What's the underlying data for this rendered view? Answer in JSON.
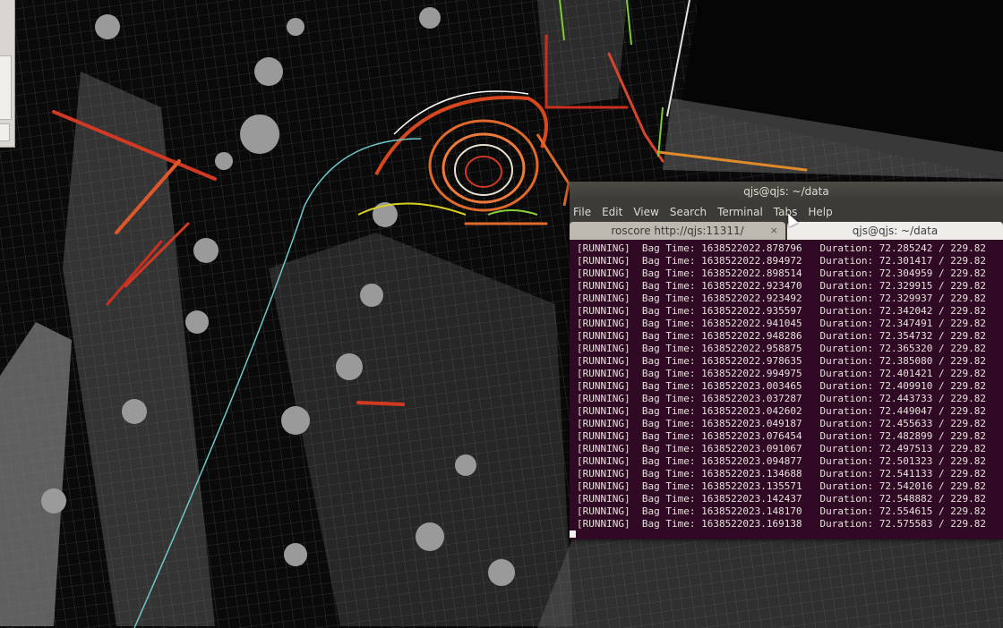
{
  "terminal": {
    "title": "qjs@qjs: ~/data",
    "menu": [
      "File",
      "Edit",
      "View",
      "Search",
      "Terminal",
      "Tabs",
      "Help"
    ],
    "tabs": [
      {
        "label": "roscore http://qjs:11311/",
        "close": "×"
      },
      {
        "label": "qjs@qjs: ~/data"
      }
    ],
    "lines": [
      "[RUNNING]  Bag Time: 1638522022.878796   Duration: 72.285242 / 229.82",
      "[RUNNING]  Bag Time: 1638522022.894972   Duration: 72.301417 / 229.82",
      "[RUNNING]  Bag Time: 1638522022.898514   Duration: 72.304959 / 229.82",
      "[RUNNING]  Bag Time: 1638522022.923470   Duration: 72.329915 / 229.82",
      "[RUNNING]  Bag Time: 1638522022.923492   Duration: 72.329937 / 229.82",
      "[RUNNING]  Bag Time: 1638522022.935597   Duration: 72.342042 / 229.82",
      "[RUNNING]  Bag Time: 1638522022.941045   Duration: 72.347491 / 229.82",
      "[RUNNING]  Bag Time: 1638522022.948286   Duration: 72.354732 / 229.82",
      "[RUNNING]  Bag Time: 1638522022.958875   Duration: 72.365320 / 229.82",
      "[RUNNING]  Bag Time: 1638522022.978635   Duration: 72.385080 / 229.82",
      "[RUNNING]  Bag Time: 1638522022.994975   Duration: 72.401421 / 229.82",
      "[RUNNING]  Bag Time: 1638522023.003465   Duration: 72.409910 / 229.82",
      "[RUNNING]  Bag Time: 1638522023.037287   Duration: 72.443733 / 229.82",
      "[RUNNING]  Bag Time: 1638522023.042602   Duration: 72.449047 / 229.82",
      "[RUNNING]  Bag Time: 1638522023.049187   Duration: 72.455633 / 229.82",
      "[RUNNING]  Bag Time: 1638522023.076454   Duration: 72.482899 / 229.82",
      "[RUNNING]  Bag Time: 1638522023.091067   Duration: 72.497513 / 229.82",
      "[RUNNING]  Bag Time: 1638522023.094877   Duration: 72.501323 / 229.82",
      "[RUNNING]  Bag Time: 1638522023.134688   Duration: 72.541133 / 229.82",
      "[RUNNING]  Bag Time: 1638522023.135571   Duration: 72.542016 / 229.82",
      "[RUNNING]  Bag Time: 1638522023.142437   Duration: 72.548882 / 229.82",
      "[RUNNING]  Bag Time: 1638522023.148170   Duration: 72.554615 / 229.82",
      "[RUNNING]  Bag Time: 1638522023.169138   Duration: 72.575583 / 229.82"
    ]
  },
  "colors": {
    "terminal_bg": "#300a24",
    "grid": "#5a5a5a",
    "points_gray": "#8a8a8a",
    "points_red": "#d7331f",
    "points_orange": "#f08a2a",
    "trajectory": "#6fc7c9"
  },
  "icons": [
    "close-icon",
    "mouse-pointer-icon",
    "text-cursor-icon"
  ]
}
